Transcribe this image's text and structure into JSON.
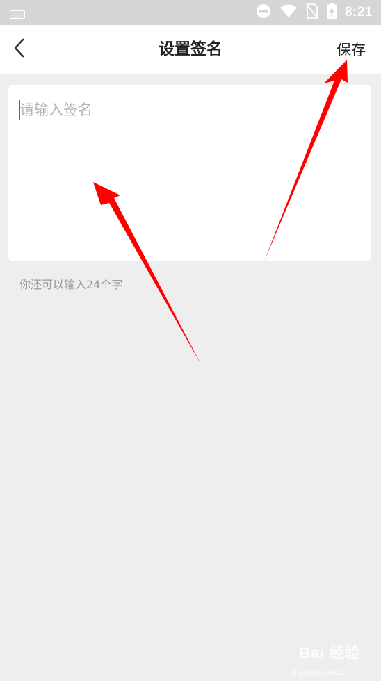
{
  "status_bar": {
    "time": "8:21",
    "icons": [
      "keyboard-icon",
      "do-not-disturb-icon",
      "wifi-icon",
      "no-sim-icon",
      "battery-charging-icon"
    ]
  },
  "header": {
    "title": "设置签名",
    "back_icon": "chevron-left-icon",
    "save_label": "保存"
  },
  "signature": {
    "placeholder": "请输入签名",
    "value": "",
    "counter_text": "你还可以输入24个字"
  },
  "annotation": {
    "arrow_color": "#ff0000",
    "arrow_count": 2
  },
  "watermark": {
    "brand": "Bai 经验",
    "url": "jingyan.baidu.com"
  },
  "colors": {
    "status_bar_bg": "#d6d6d6",
    "page_bg": "#eeeeee",
    "card_bg": "#ffffff",
    "placeholder": "#b4b4b4",
    "counter": "#9a9a9a"
  }
}
